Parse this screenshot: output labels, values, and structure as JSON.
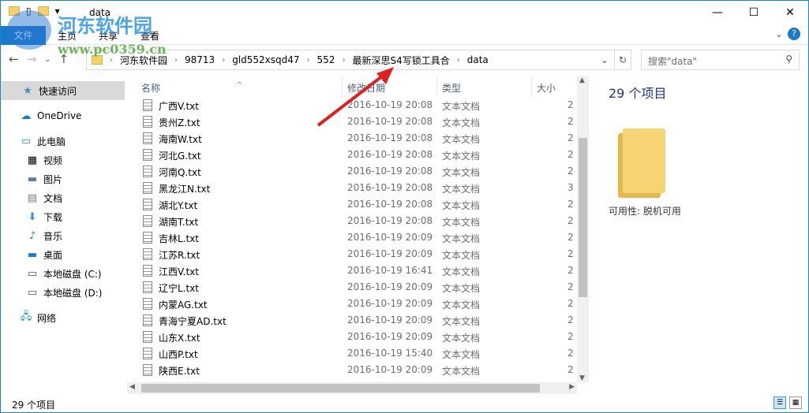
{
  "window": {
    "title": "data",
    "minimize": "—",
    "maximize": "☐",
    "close": "✕"
  },
  "ribbon": {
    "file": "文件",
    "tabs": [
      "主页",
      "共享",
      "查看"
    ],
    "help": "?",
    "collapse": "⌄"
  },
  "watermark": {
    "name": "河东软件园",
    "url": "www.pc0359.cn"
  },
  "address": {
    "crumbs": [
      "河东软件园",
      "98713",
      "gld552xsqd47",
      "552",
      "最新深思S4写锁工具合",
      "data"
    ],
    "search_placeholder": "搜索\"data\""
  },
  "nav": {
    "quick": "快速访问",
    "onedrive": "OneDrive",
    "pc": "此电脑",
    "video": "视频",
    "pictures": "图片",
    "docs": "文档",
    "downloads": "下载",
    "music": "音乐",
    "desktop": "桌面",
    "c": "本地磁盘 (C:)",
    "d": "本地磁盘 (D:)",
    "network": "网络"
  },
  "columns": {
    "name": "名称",
    "date": "修改日期",
    "type": "类型",
    "size": "大小"
  },
  "files": [
    {
      "name": "广西V.txt",
      "date": "2016-10-19 20:08",
      "type": "文本文档",
      "size": "2"
    },
    {
      "name": "贵州Z.txt",
      "date": "2016-10-19 20:08",
      "type": "文本文档",
      "size": "2"
    },
    {
      "name": "海南W.txt",
      "date": "2016-10-19 20:08",
      "type": "文本文档",
      "size": "2"
    },
    {
      "name": "河北G.txt",
      "date": "2016-10-19 20:08",
      "type": "文本文档",
      "size": "2"
    },
    {
      "name": "河南Q.txt",
      "date": "2016-10-19 20:08",
      "type": "文本文档",
      "size": "2"
    },
    {
      "name": "黑龙江N.txt",
      "date": "2016-10-19 20:08",
      "type": "文本文档",
      "size": "3"
    },
    {
      "name": "湖北Y.txt",
      "date": "2016-10-19 20:08",
      "type": "文本文档",
      "size": "2"
    },
    {
      "name": "湖南T.txt",
      "date": "2016-10-19 20:08",
      "type": "文本文档",
      "size": "2"
    },
    {
      "name": "吉林L.txt",
      "date": "2016-10-19 20:09",
      "type": "文本文档",
      "size": "2"
    },
    {
      "name": "江苏R.txt",
      "date": "2016-10-19 20:09",
      "type": "文本文档",
      "size": "2"
    },
    {
      "name": "江西V.txt",
      "date": "2016-10-19 16:41",
      "type": "文本文档",
      "size": "2"
    },
    {
      "name": "辽宁L.txt",
      "date": "2016-10-19 20:09",
      "type": "文本文档",
      "size": "2"
    },
    {
      "name": "内蒙AG.txt",
      "date": "2016-10-19 20:09",
      "type": "文本文档",
      "size": "2"
    },
    {
      "name": "青海宁夏AD.txt",
      "date": "2016-10-19 20:09",
      "type": "文本文档",
      "size": "2"
    },
    {
      "name": "山东X.txt",
      "date": "2016-10-19 20:09",
      "type": "文本文档",
      "size": "2"
    },
    {
      "name": "山西P.txt",
      "date": "2016-10-19 15:40",
      "type": "文本文档",
      "size": "2"
    },
    {
      "name": "陕西E.txt",
      "date": "2016-10-19 20:09",
      "type": "文本文档",
      "size": "2"
    }
  ],
  "details": {
    "count": "29 个项目",
    "availability": "可用性:   脱机可用"
  },
  "status": "29 个项目"
}
